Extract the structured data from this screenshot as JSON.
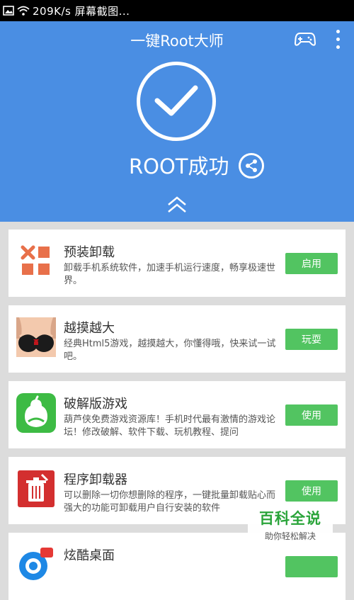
{
  "status_bar": {
    "text": "209K/s 屏幕截图..."
  },
  "header": {
    "title": "一键Root大师",
    "status": "ROOT成功"
  },
  "colors": {
    "accent": "#4a8ee3",
    "button": "#52c461"
  },
  "apps": [
    {
      "title": "预装卸载",
      "desc": "卸载手机系统软件，加速手机运行速度，畅享极速世界。",
      "action": "启用",
      "icon": "uninstall-icon"
    },
    {
      "title": "越摸越大",
      "desc": "经典Html5游戏，越摸越大，你懂得哦，快来试一试吧。",
      "action": "玩耍",
      "icon": "game-thumbnail"
    },
    {
      "title": "破解版游戏",
      "desc": "葫芦侠免费游戏资源库！手机时代最有激情的游戏论坛！修改破解、软件下载、玩机教程、提问",
      "action": "使用",
      "icon": "gourd-icon"
    },
    {
      "title": "程序卸载器",
      "desc": "可以删除一切你想删除的程序，一键批量卸载贴心而强大的功能可卸载用户自行安装的软件",
      "action": "使用",
      "icon": "trash-icon"
    },
    {
      "title": "炫酷桌面",
      "desc": "",
      "action": "",
      "icon": "desktop-app-icon"
    }
  ],
  "watermark": {
    "main": "百科全说",
    "sub": "助你轻松解决"
  }
}
